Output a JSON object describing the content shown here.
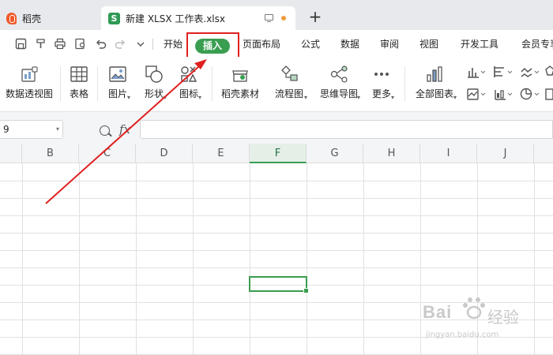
{
  "tabs": [
    {
      "label": "稻壳"
    },
    {
      "label": "新建 XLSX 工作表.xlsx"
    }
  ],
  "menu": {
    "items": [
      {
        "label": "开始"
      },
      {
        "label": "插入"
      },
      {
        "label": "页面布局"
      },
      {
        "label": "公式"
      },
      {
        "label": "数据"
      },
      {
        "label": "审阅"
      },
      {
        "label": "视图"
      },
      {
        "label": "开发工具"
      },
      {
        "label": "会员专享"
      }
    ],
    "active_index": 1
  },
  "ribbon": {
    "buttons": [
      {
        "label": "数据透视图"
      },
      {
        "label": "表格"
      },
      {
        "label": "图片"
      },
      {
        "label": "形状"
      },
      {
        "label": "图标"
      },
      {
        "label": "稻壳素材"
      },
      {
        "label": "流程图"
      },
      {
        "label": "思维导图"
      },
      {
        "label": "更多"
      },
      {
        "label": "全部图表"
      }
    ]
  },
  "formula_bar": {
    "name_box": "9",
    "fx_label": "fx",
    "formula": ""
  },
  "sheet": {
    "columns": [
      "B",
      "C",
      "D",
      "E",
      "F",
      "G",
      "H",
      "I",
      "J"
    ],
    "active_column": "F"
  },
  "watermark": {
    "brand": "Bai",
    "suffix": "经验",
    "url": "jingyan.baidu.com"
  },
  "colors": {
    "accent": "#3a9e51",
    "annotation": "#e02020",
    "tab_bar": "#e8e9ec"
  }
}
